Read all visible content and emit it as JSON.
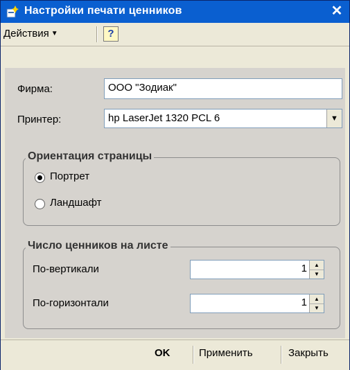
{
  "window": {
    "title": "Настройки печати ценников",
    "close_glyph": "✕"
  },
  "toolbar": {
    "actions_label": "Действия",
    "help_label": "?"
  },
  "form": {
    "firm_label": "Фирма:",
    "firm_value": "ООО \"Зодиак\"",
    "printer_label": "Принтер:",
    "printer_value": "hp LaserJet 1320 PCL 6"
  },
  "orientation": {
    "title": "Ориентация страницы",
    "options": [
      {
        "label": "Портрет",
        "checked": true
      },
      {
        "label": "Ландшафт",
        "checked": false
      }
    ]
  },
  "labels_count": {
    "title": "Число ценников на листе",
    "vertical_label": "По-вертикали",
    "vertical_value": "1",
    "horizontal_label": "По-горизонтали",
    "horizontal_value": "1"
  },
  "footer": {
    "ok_label": "OK",
    "apply_label": "Применить",
    "close_label": "Закрыть"
  },
  "icons": [
    "app-icon",
    "close-icon",
    "chevron-down-icon",
    "help-icon",
    "dropdown-arrow-icon",
    "spin-up-icon",
    "spin-down-icon"
  ]
}
